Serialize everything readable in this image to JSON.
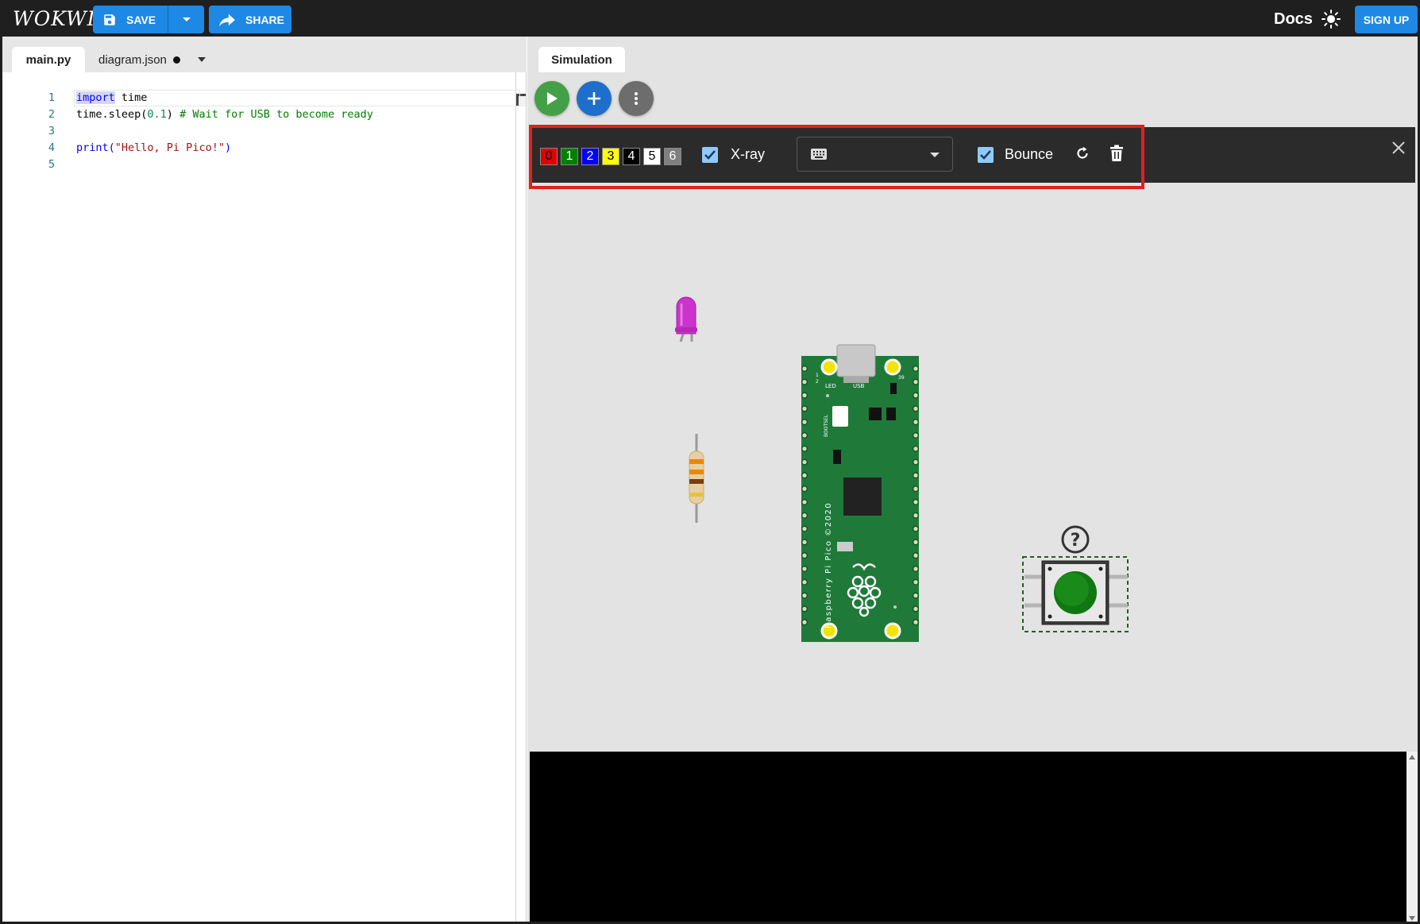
{
  "app": {
    "logo": "WOKWI",
    "save_label": "SAVE",
    "share_label": "SHARE",
    "docs_label": "Docs",
    "signup_label": "SIGN UP"
  },
  "editor": {
    "tabs": [
      {
        "label": "main.py",
        "active": true
      },
      {
        "label": "diagram.json",
        "modified": true
      }
    ],
    "lines": [
      {
        "n": "1",
        "tokens": [
          {
            "t": "import",
            "c": "kw-hl"
          },
          {
            "t": " time",
            "c": ""
          }
        ]
      },
      {
        "n": "2",
        "tokens": [
          {
            "t": "time.sleep(",
            "c": ""
          },
          {
            "t": "0.1",
            "c": "num"
          },
          {
            "t": ") ",
            "c": ""
          },
          {
            "t": "# Wait for USB to become ready",
            "c": "cmt"
          }
        ]
      },
      {
        "n": "3",
        "tokens": []
      },
      {
        "n": "4",
        "tokens": [
          {
            "t": "print(",
            "c": "fn"
          },
          {
            "t": "\"Hello, Pi Pico!\"",
            "c": "str"
          },
          {
            "t": ")",
            "c": "fn"
          }
        ]
      },
      {
        "n": "5",
        "tokens": []
      }
    ]
  },
  "simulation": {
    "tab_label": "Simulation",
    "toolbar": {
      "wire_colors": [
        {
          "label": "0",
          "bg": "#e00000",
          "fg": "#000000"
        },
        {
          "label": "1",
          "bg": "#008000",
          "fg": "#ffffff"
        },
        {
          "label": "2",
          "bg": "#0000ff",
          "fg": "#ffffff"
        },
        {
          "label": "3",
          "bg": "#ffff00",
          "fg": "#000000"
        },
        {
          "label": "4",
          "bg": "#000000",
          "fg": "#ffffff"
        },
        {
          "label": "5",
          "bg": "#ffffff",
          "fg": "#000000"
        },
        {
          "label": "6",
          "bg": "#808080",
          "fg": "#ffffff"
        }
      ],
      "xray_label": "X-ray",
      "xray_checked": true,
      "bounce_label": "Bounce",
      "bounce_checked": true,
      "key_binding_value": ""
    },
    "parts": {
      "led_color": "#cc33cc",
      "board_name": "Raspberry Pi Pico ©2020",
      "board_labels": [
        "LED",
        "USB",
        "BOOTSEL",
        "1",
        "2",
        "39"
      ],
      "pushbutton_color": "#1a8a1a",
      "help_label": "?"
    }
  },
  "colors": {
    "accent": "#1e88e5",
    "topbar": "#1f1f1f",
    "highlight": "#e02020"
  }
}
